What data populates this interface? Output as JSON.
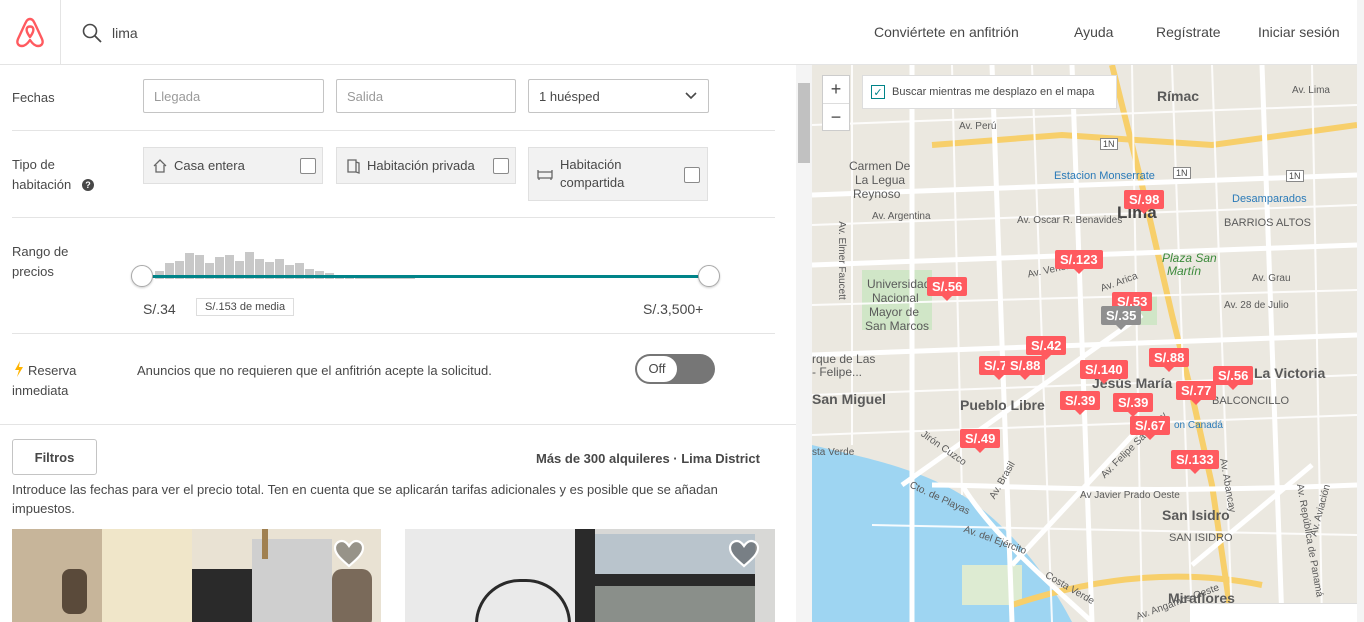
{
  "header": {
    "search_value": "lima",
    "nav": [
      "Conviértete en anfitrión",
      "Ayuda",
      "Regístrate",
      "Iniciar sesión"
    ]
  },
  "filters": {
    "dates_label": "Fechas",
    "checkin_placeholder": "Llegada",
    "checkout_placeholder": "Salida",
    "guests_value": "1 huésped",
    "room_type_label_1": "Tipo de",
    "room_type_label_2": "habitación",
    "room_types": [
      "Casa entera",
      "Habitación privada",
      "Habitación",
      "compartida"
    ],
    "price_label_1": "Rango de",
    "price_label_2": "precios",
    "price_min": "S/.34",
    "price_avg": "S/.153 de media",
    "price_max": "S/.3,500+",
    "instant_label_1": "Reserva",
    "instant_label_2": "inmediata",
    "instant_desc": "Anuncios que no requieren que el anfitrión acepte la solicitud.",
    "instant_toggle": "Off",
    "filters_button": "Filtros",
    "results_count": "Más de 300 alquileres · Lima District",
    "notice": "Introduce las fechas para ver el precio total. Ten en cuenta que se aplicarán tarifas adicionales y es posible que se añadan",
    "notice_2": "impuestos."
  },
  "map": {
    "zoom_in": "+",
    "zoom_out": "−",
    "search_on_move": "Buscar mientras me desplazo en el mapa",
    "places": [
      "Rímac",
      "Lima",
      "BARRIOS ALTOS",
      "Plaza San",
      "Martín",
      "Universidad",
      "Nacional",
      "Mayor de",
      "San Marcos",
      "Carmen De",
      "La Legua",
      "Reynoso",
      "San Miguel",
      "Pueblo Libre",
      "Jesús María",
      "La Victoria",
      "BALCONCILLO",
      "San Isidro",
      "SAN ISIDRO",
      "Miraflores",
      "Estacion Monserrate",
      "Desamparados",
      "rque de Las",
      "- Felipe...",
      "sta Verde",
      "on Canadá"
    ],
    "streets": [
      "Av. Perú",
      "Av. Argentina",
      "Av. Oscar R. Benavides",
      "Av. Venezuela",
      "Av. Grau",
      "Av. 28 de Julio",
      "Jirón Cuzco",
      "Av. Brasil",
      "Av Javier Prado Oeste",
      "Av. del Ejército",
      "Cto. de Playas",
      "Costa Verde",
      "Av. Elmer Faucett",
      "Av. Lima",
      "Av. Arica",
      "Av. Felipe Salaverry",
      "Av. Angamos Oeste",
      "Av. República de Panamá",
      "Av. Aviación",
      "Av. Abancay"
    ],
    "prices": [
      "S/.98",
      "S/.123",
      "S/.56",
      "S/.53",
      "S/.35",
      "S/.42",
      "S/.70",
      "S/.88",
      "S/.140",
      "S/.88",
      "S/.56",
      "S/.77",
      "S/.39",
      "S/.39",
      "S/.67",
      "S/.49",
      "S/.133"
    ]
  },
  "colors": {
    "brand": "#FF5A5F",
    "slider": "#008489"
  }
}
